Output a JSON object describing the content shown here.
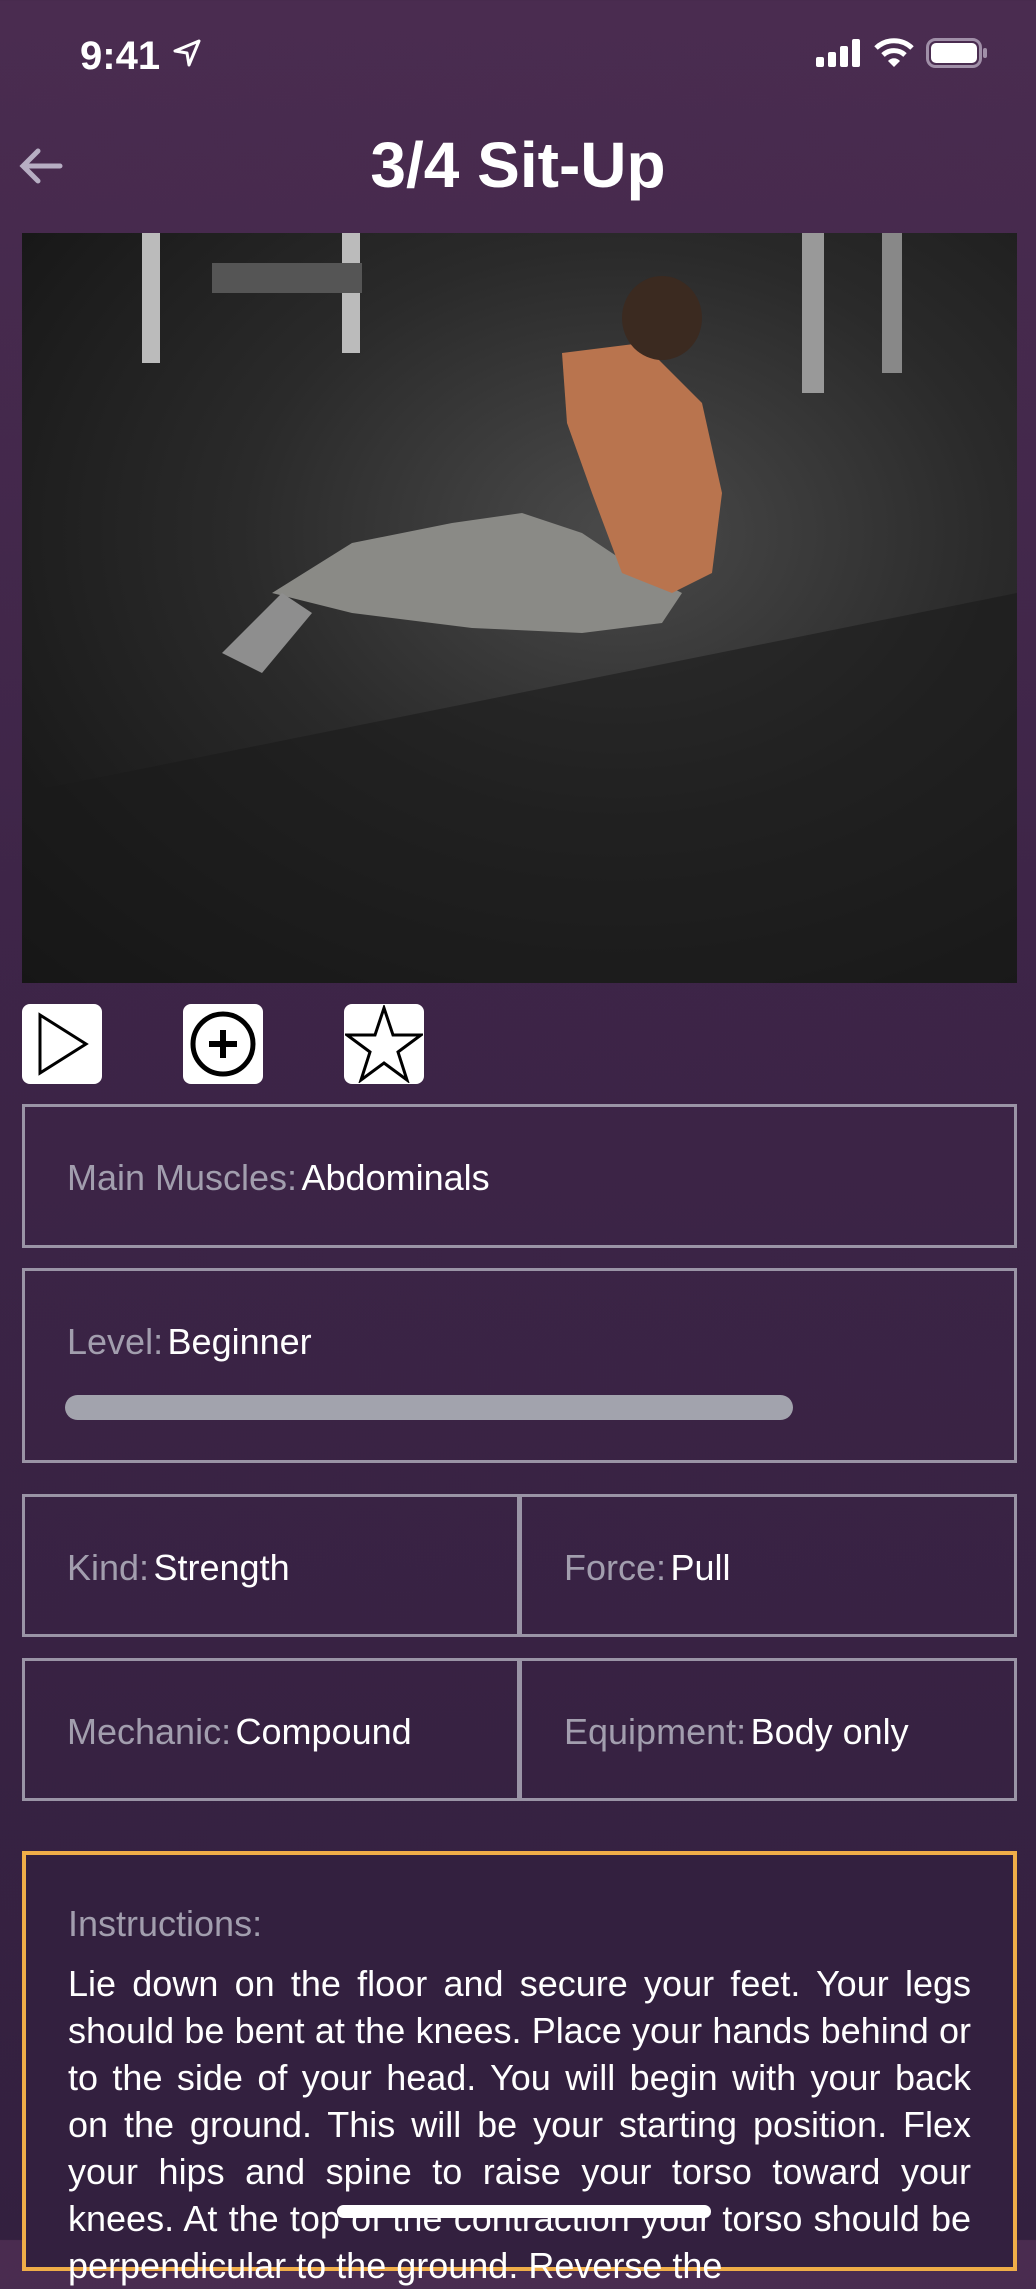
{
  "status_bar": {
    "time": "9:41"
  },
  "header": {
    "title": "3/4 Sit-Up"
  },
  "actions": [
    {
      "name": "play"
    },
    {
      "name": "add"
    },
    {
      "name": "favorite"
    }
  ],
  "details": {
    "main_muscles": {
      "label": "Main Muscles:",
      "value": "Abdominals"
    },
    "level": {
      "label": "Level:",
      "value": "Beginner",
      "progress_fraction": 0.75
    },
    "kind": {
      "label": "Kind:",
      "value": "Strength"
    },
    "force": {
      "label": "Force:",
      "value": "Pull"
    },
    "mechanic": {
      "label": "Mechanic:",
      "value": "Compound"
    },
    "equipment": {
      "label": "Equipment:",
      "value": "Body only"
    }
  },
  "instructions": {
    "label": "Instructions:",
    "text": "Lie down on the floor and secure your feet. Your legs should be bent at the knees. Place your hands behind or to the side of your head. You will begin with your back on the ground. This will be your starting position. Flex your hips and spine to raise your torso toward your knees. At the top of the contraction your torso should be perpendicular to the ground. Reverse the"
  },
  "colors": {
    "accent": "#f0ad48",
    "background": "#3e2548",
    "border": "#9a94a6"
  }
}
